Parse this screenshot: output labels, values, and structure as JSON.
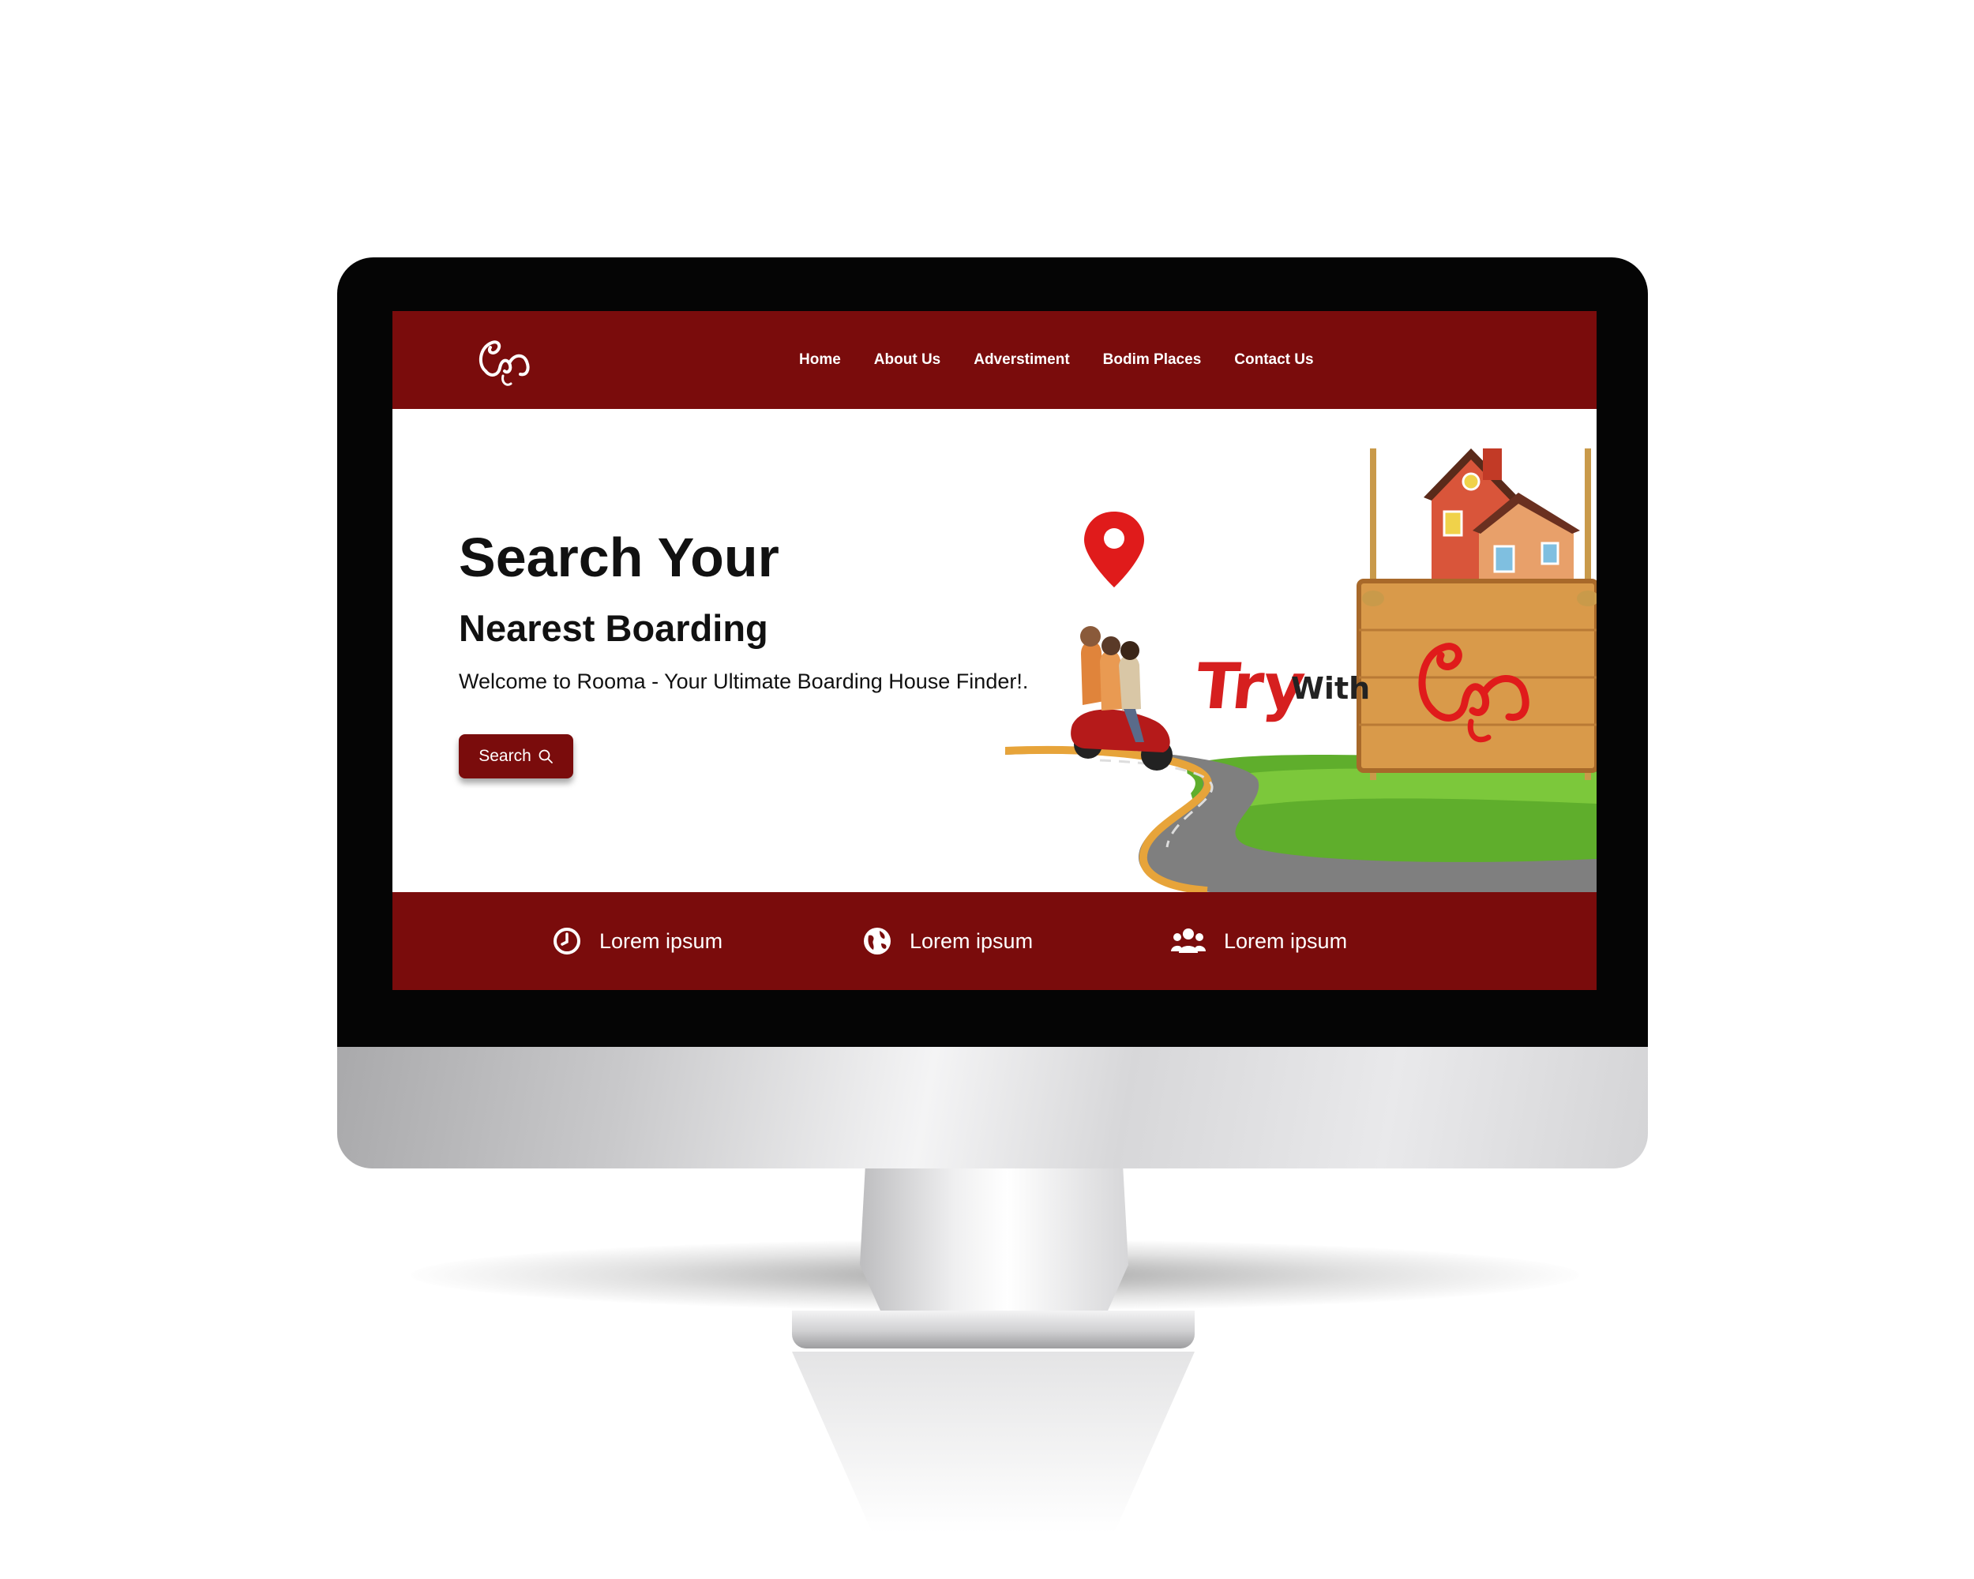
{
  "site": {
    "logo_name": "rooma-logo",
    "nav": [
      "Home",
      "About Us",
      "Adverstiment",
      "Bodim Places",
      "Contact Us"
    ]
  },
  "hero": {
    "title": "Search Your",
    "subtitle": "Nearest Boarding",
    "welcome": "Welcome to Rooma - Your Ultimate Boarding House Finder!.",
    "search_label": "Search",
    "banner_try": "Try",
    "banner_with": "With"
  },
  "features": [
    {
      "icon": "clock-icon",
      "label": "Lorem ipsum"
    },
    {
      "icon": "globe-icon",
      "label": "Lorem ipsum"
    },
    {
      "icon": "users-icon",
      "label": "Lorem ipsum"
    }
  ],
  "colors": {
    "brand": "#7a0c0c",
    "accent_red": "#d61f1f",
    "bezel": "#050505"
  }
}
